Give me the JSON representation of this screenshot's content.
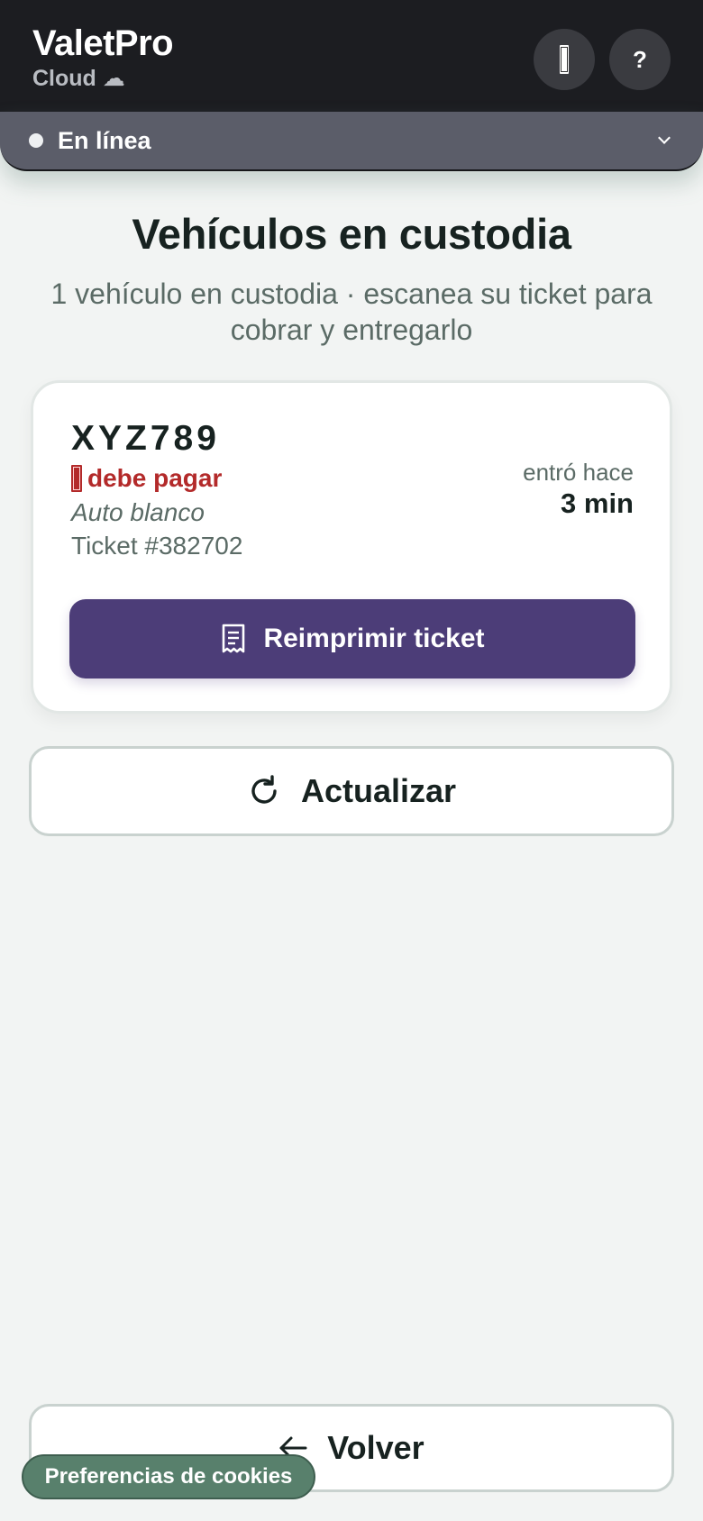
{
  "header": {
    "app_name": "ValetPro",
    "app_subtitle": "Cloud ☁",
    "help_label": "?",
    "icons": {
      "left_button": "ticket-icon",
      "right_button": "help-icon"
    }
  },
  "status": {
    "label": "En línea",
    "icon": "chevron-down-icon"
  },
  "main": {
    "title": "Vehículos en custodia",
    "subtitle": "1 vehículo en custodia · escanea su ticket para cobrar y entregarlo"
  },
  "vehicles": [
    {
      "plate": "XYZ789",
      "payment_status": "debe pagar",
      "description": "Auto blanco",
      "ticket": "Ticket #382702",
      "entered_label": "entró hace",
      "entered_value": "3 min",
      "reprint_label": "Reimprimir ticket"
    }
  ],
  "actions": {
    "refresh_label": "Actualizar",
    "back_label": "Volver"
  },
  "cookie": {
    "label": "Preferencias de cookies"
  },
  "colors": {
    "header_bg": "#1c1d21",
    "status_bar_bg": "#5b5d69",
    "page_bg": "#f2f4f3",
    "primary_button": "#4c3d78",
    "payment_due": "#b32a2a",
    "cookie_pill": "#58806c"
  }
}
